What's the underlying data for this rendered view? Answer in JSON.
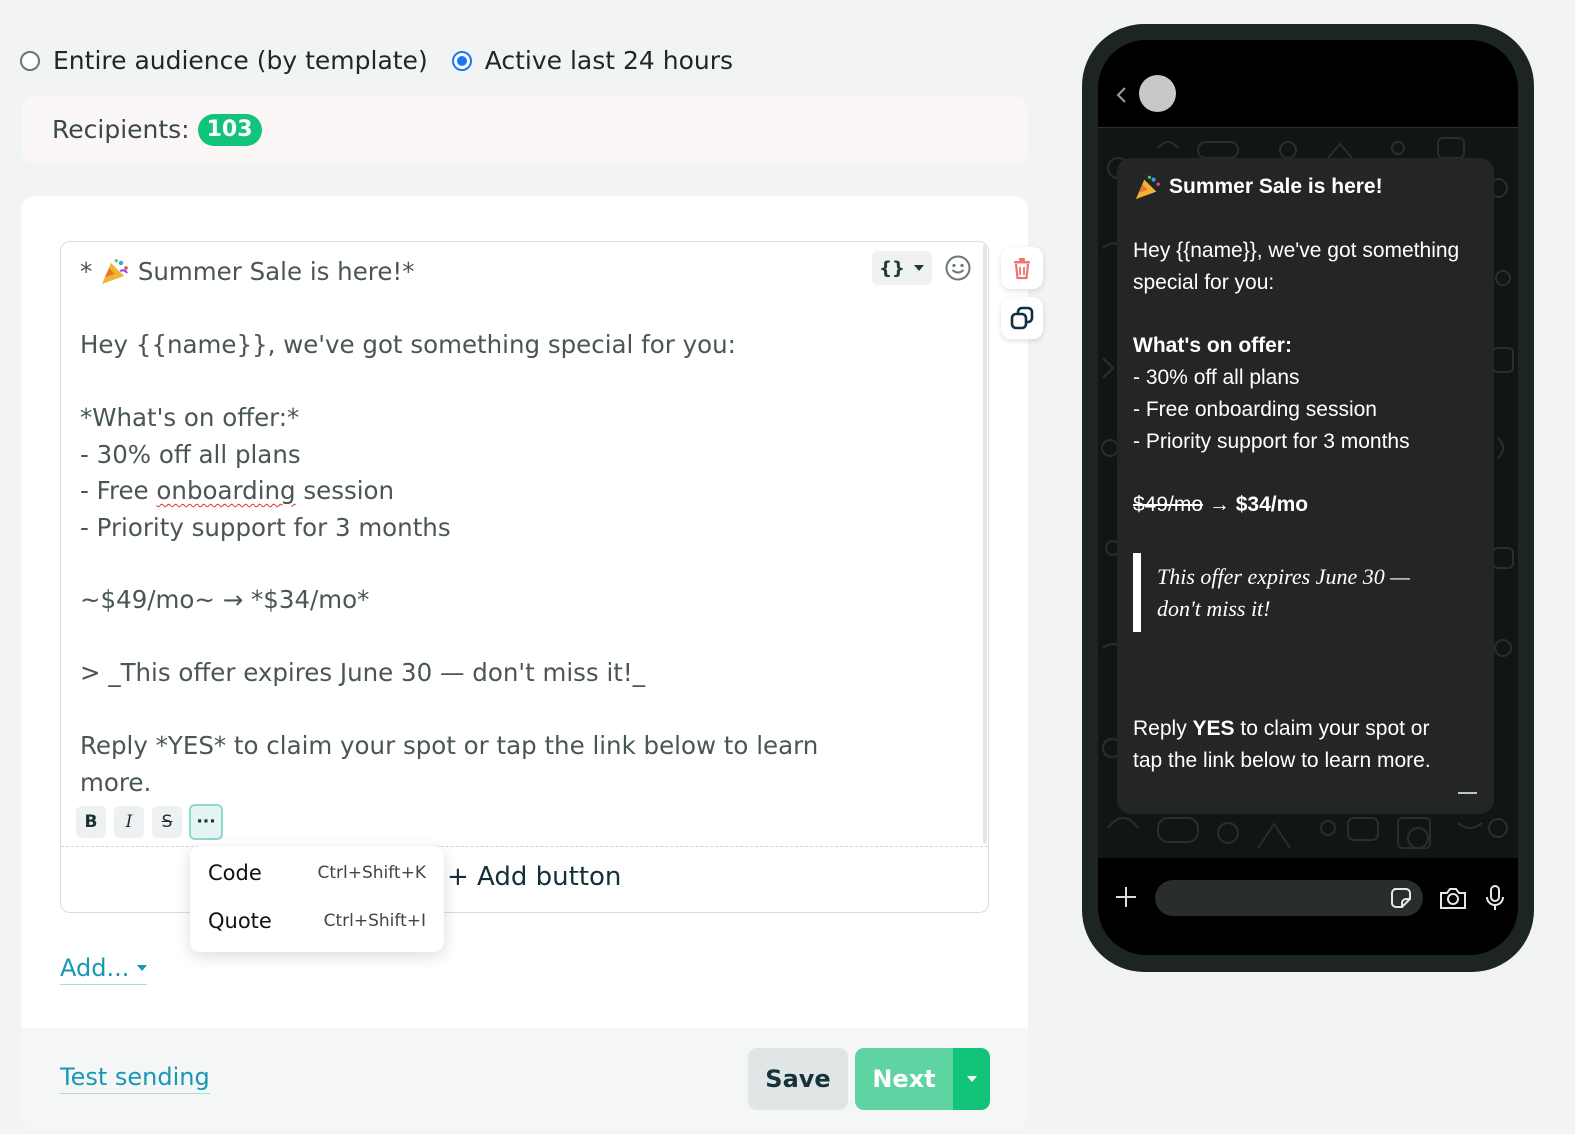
{
  "audience": {
    "options": [
      {
        "label": "Entire audience (by template)",
        "selected": false
      },
      {
        "label": "Active last 24 hours",
        "selected": true
      }
    ],
    "recipients_label": "Recipients:",
    "recipients_count": "103"
  },
  "editor": {
    "lines": {
      "l1_prefix": "*",
      "l1_title": " Summer Sale is here!*",
      "l2": "Hey {{name}}, we've got something special for you:",
      "l3": "*What's on offer:*",
      "l4": "- 30% off all plans",
      "l5_a": "- Free ",
      "l5_b": "onboarding",
      "l5_c": " session",
      "l6": "- Priority support for 3 months",
      "l7": "~$49/mo~ → *$34/mo*",
      "l8": "> _This offer expires June 30 — don't miss it!_",
      "l9": "Reply *YES* to claim your spot or tap the link below to learn",
      "l10": "more."
    },
    "format_buttons": {
      "bold": "B",
      "italic": "I",
      "strike": "S",
      "more": "···"
    },
    "add_button_label": "+ Add button"
  },
  "format_menu": {
    "items": [
      {
        "label": "Code",
        "shortcut": "Ctrl+Shift+K"
      },
      {
        "label": "Quote",
        "shortcut": "Ctrl+Shift+I"
      }
    ]
  },
  "add_link": "Add...",
  "footer": {
    "test_sending": "Test sending",
    "save": "Save",
    "next": "Next"
  },
  "preview": {
    "title": "Summer Sale is here!",
    "greeting_1": "Hey {{name}}, we've got something",
    "greeting_2": "special for you:",
    "offer_heading": "What's on offer:",
    "offer_1": "- 30% off all plans",
    "offer_2": "- Free onboarding session",
    "offer_3": "- Priority support for 3 months",
    "old_price": "$49/mo",
    "arrow": " → ",
    "new_price": "$34/mo",
    "quote_1": "This offer expires June 30 —",
    "quote_2": "don't miss it!",
    "reply_a": "Reply ",
    "reply_b": "YES",
    "reply_c": " to claim your spot or",
    "reply_2": "tap the link below to learn more."
  },
  "colors": {
    "accent": "#12c47a",
    "link": "#1a96b6",
    "radio": "#1877f2"
  }
}
